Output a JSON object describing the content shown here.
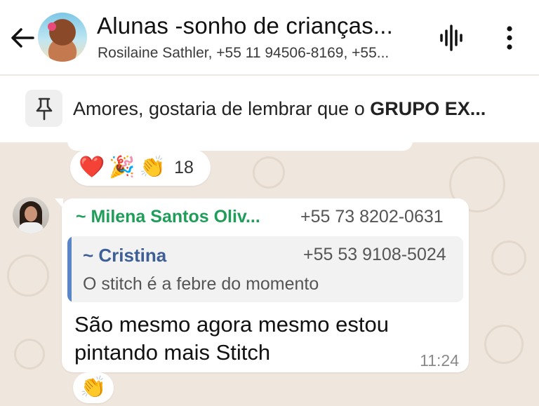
{
  "header": {
    "title": "Alunas -sonho de crianças...",
    "subtitle": "Rosilaine Sathler, +55 11 94506-8169, +55..."
  },
  "pinned": {
    "text_prefix": "Amores, gostaria de lembrar que o ",
    "text_bold": "GRUPO EX..."
  },
  "previous_message": {
    "reactions": [
      "❤️",
      "🎉",
      "👏"
    ],
    "reaction_count": "18"
  },
  "message": {
    "sender_name": "~ Milena Santos Oliv...",
    "sender_phone": "+55 73 8202-0631",
    "quoted": {
      "name": "~ Cristina",
      "phone": "+55 53 9108-5024",
      "text": "O stitch é a febre do momento"
    },
    "text": "São mesmo agora mesmo estou pintando mais Stitch",
    "time": "11:24",
    "reaction": "👏"
  },
  "colors": {
    "sender": "#1f9e5a",
    "quote_name": "#3d5e96",
    "quote_bar": "#5a86c8",
    "wallpaper": "#efe7de"
  }
}
